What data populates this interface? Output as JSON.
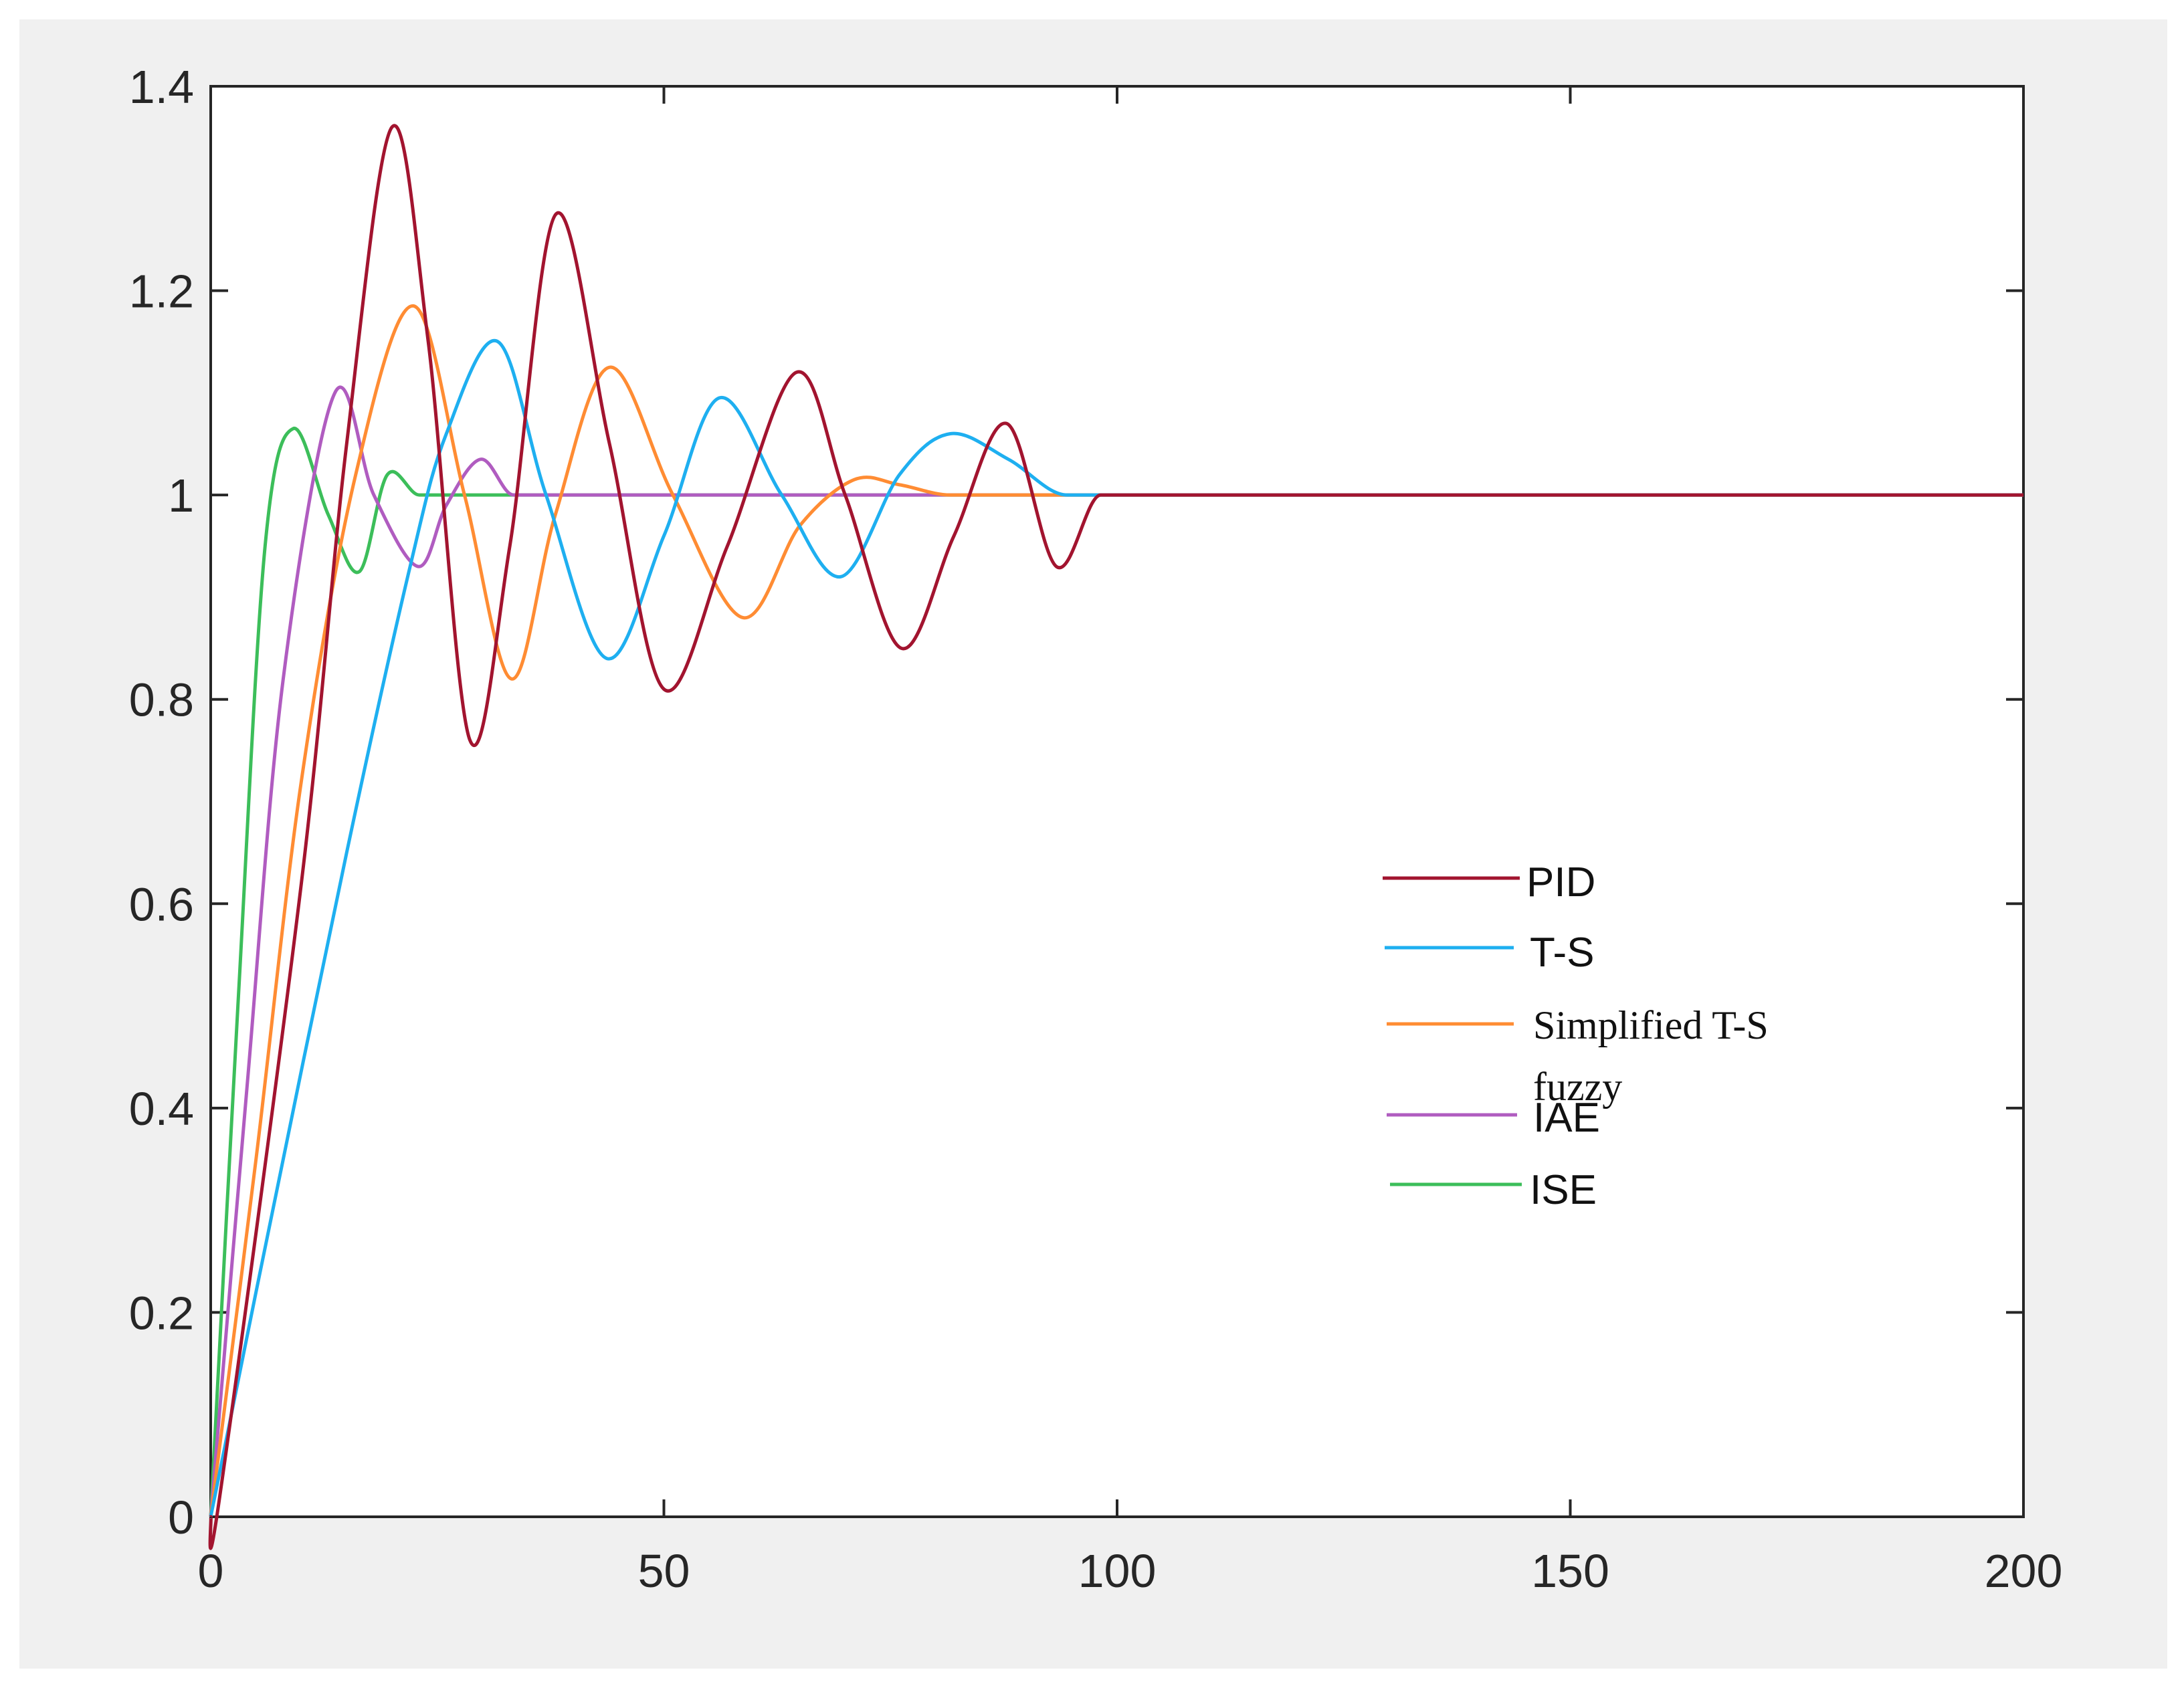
{
  "chart_data": {
    "type": "line",
    "title": "",
    "xlabel": "",
    "ylabel": "",
    "xlim": [
      0,
      200
    ],
    "ylim": [
      0,
      1.4
    ],
    "xticks": [
      "0",
      "50",
      "100",
      "150",
      "200"
    ],
    "yticks": [
      "0",
      "0.2",
      "0.4",
      "0.6",
      "0.8",
      "1",
      "1.2",
      "1.4"
    ],
    "grid": false,
    "legend_position": "lower-right",
    "series": [
      {
        "name": "PID",
        "color": "#A2142F",
        "points": [
          [
            0,
            0
          ],
          [
            1,
            0.02
          ],
          [
            10,
            0.62
          ],
          [
            15,
            1.05
          ],
          [
            20,
            1.36
          ],
          [
            24,
            1.15
          ],
          [
            28.6,
            0.76
          ],
          [
            33,
            0.95
          ],
          [
            38.1,
            1.275
          ],
          [
            44,
            1.05
          ],
          [
            50,
            0.81
          ],
          [
            57,
            0.95
          ],
          [
            64.6,
            1.12
          ],
          [
            70,
            1.0
          ],
          [
            76.2,
            0.85
          ],
          [
            82,
            0.96
          ],
          [
            87.8,
            1.07
          ],
          [
            93.3,
            0.93
          ],
          [
            98.2,
            1.0
          ],
          [
            200,
            1.0
          ]
        ]
      },
      {
        "name": "T-S",
        "color": "#1EAFF0",
        "points": [
          [
            0,
            0
          ],
          [
            5,
            0.22
          ],
          [
            15,
            0.65
          ],
          [
            22,
            0.93
          ],
          [
            26,
            1.06
          ],
          [
            31.7,
            1.15
          ],
          [
            37,
            1.0
          ],
          [
            43.7,
            0.84
          ],
          [
            50,
            0.96
          ],
          [
            56.1,
            1.095
          ],
          [
            63,
            1.0
          ],
          [
            69.5,
            0.92
          ],
          [
            76,
            1.02
          ],
          [
            81.6,
            1.06
          ],
          [
            88,
            1.035
          ],
          [
            94.5,
            1.0
          ],
          [
            200,
            1.0
          ]
        ]
      },
      {
        "name": "Simplified T-S fuzzy",
        "color": "#FF8C33",
        "points": [
          [
            0,
            0
          ],
          [
            5,
            0.35
          ],
          [
            10,
            0.72
          ],
          [
            16,
            1.02
          ],
          [
            22.4,
            1.185
          ],
          [
            28,
            1.0
          ],
          [
            33.2,
            0.82
          ],
          [
            38,
            0.98
          ],
          [
            44,
            1.125
          ],
          [
            51,
            1.0
          ],
          [
            58.7,
            0.88
          ],
          [
            65,
            0.97
          ],
          [
            71,
            1.015
          ],
          [
            76,
            1.01
          ],
          [
            81.6,
            1.0
          ],
          [
            200,
            1.0
          ]
        ]
      },
      {
        "name": "IAE",
        "color": "#B05CC0",
        "points": [
          [
            0,
            0
          ],
          [
            4,
            0.42
          ],
          [
            8,
            0.82
          ],
          [
            13.7,
            1.1
          ],
          [
            18,
            1.0
          ],
          [
            22.9,
            0.93
          ],
          [
            26,
            0.99
          ],
          [
            29.8,
            1.035
          ],
          [
            33.4,
            1.0
          ],
          [
            200,
            1.0
          ]
        ]
      },
      {
        "name": "ISE",
        "color": "#3CBE5A",
        "points": [
          [
            0,
            0
          ],
          [
            3,
            0.5
          ],
          [
            6,
            0.95
          ],
          [
            9.1,
            1.065
          ],
          [
            13,
            0.98
          ],
          [
            16.4,
            0.925
          ],
          [
            19.5,
            1.02
          ],
          [
            23,
            1.0
          ],
          [
            200,
            1.0
          ]
        ]
      }
    ]
  }
}
